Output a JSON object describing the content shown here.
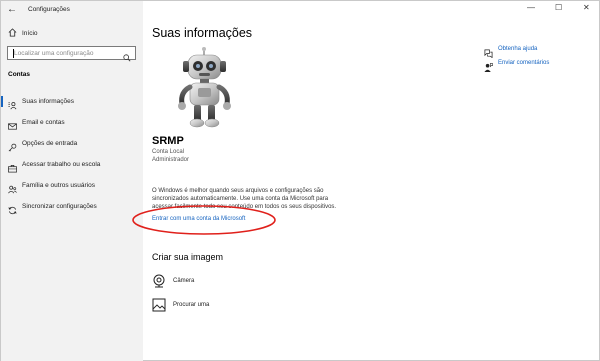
{
  "window": {
    "title": "Configurações",
    "back_glyph": "←",
    "min_glyph": "—",
    "max_glyph": "☐",
    "close_glyph": "✕"
  },
  "sidebar": {
    "home_label": "Início",
    "search_placeholder": "Localizar uma configuração",
    "section_title": "Contas",
    "items": [
      {
        "label": "Suas informações",
        "icon": "person-card-icon",
        "active": true
      },
      {
        "label": "Email e contas",
        "icon": "envelope-icon",
        "active": false
      },
      {
        "label": "Opções de entrada",
        "icon": "key-icon",
        "active": false
      },
      {
        "label": "Acessar trabalho ou escola",
        "icon": "briefcase-icon",
        "active": false
      },
      {
        "label": "Família e outros usuários",
        "icon": "people-icon",
        "active": false
      },
      {
        "label": "Sincronizar configurações",
        "icon": "sync-icon",
        "active": false
      }
    ]
  },
  "main": {
    "title": "Suas informações",
    "user": {
      "name": "SRMP",
      "account_type": "Conta Local",
      "role": "Administrador"
    },
    "info_text": "O Windows é melhor quando seus arquivos e configurações são sincronizados automaticamente. Use uma conta da Microsoft para acessar facilmente todo seu conteúdo em todos os seus dispositivos.",
    "ms_link": "Entrar com uma conta da Microsoft",
    "create_image_title": "Criar sua imagem",
    "image_options": [
      {
        "label": "Câmera",
        "icon": "camera-icon"
      },
      {
        "label": "Procurar uma",
        "icon": "browse-icon"
      }
    ]
  },
  "right_links": [
    {
      "label": "Obtenha ajuda",
      "icon": "help-chat-icon"
    },
    {
      "label": "Enviar comentários",
      "icon": "feedback-person-icon"
    }
  ],
  "colors": {
    "accent": "#1664c0",
    "sidebar_bg": "#f2f2f2",
    "highlight_ellipse": "#e0201b"
  }
}
